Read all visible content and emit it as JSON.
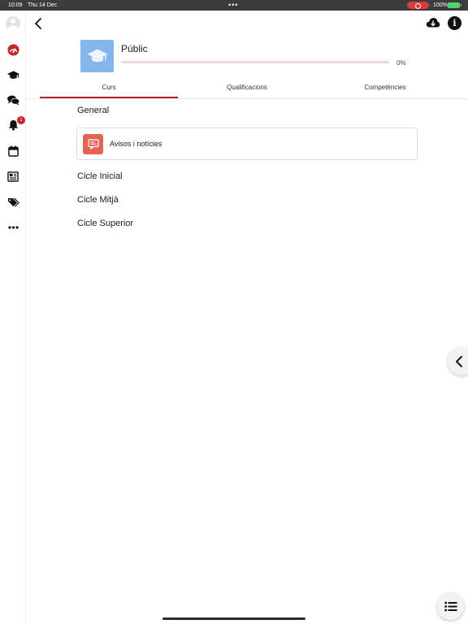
{
  "status_bar": {
    "time": "10:09",
    "date": "Thu 14 Dec",
    "battery": "100%"
  },
  "sidebar": {
    "notification_count": "1",
    "items": [
      {
        "icon": "dashboard-icon"
      },
      {
        "icon": "graduation-cap-icon"
      },
      {
        "icon": "chat-icon"
      },
      {
        "icon": "bell-icon"
      },
      {
        "icon": "calendar-icon"
      },
      {
        "icon": "news-icon"
      },
      {
        "icon": "tags-icon"
      },
      {
        "icon": "more-icon"
      }
    ]
  },
  "course": {
    "title": "Públic",
    "progress_percent": 0,
    "progress_text": "0%"
  },
  "tabs": [
    {
      "label": "Curs",
      "active": true
    },
    {
      "label": "Qualificacions",
      "active": false
    },
    {
      "label": "Competències",
      "active": false
    }
  ],
  "sections": [
    {
      "title": "General",
      "modules": [
        {
          "label": "Avisos i notícies",
          "icon": "forum-icon"
        }
      ]
    },
    {
      "title": "Cicle Inicial"
    },
    {
      "title": "Cicle Mitjà"
    },
    {
      "title": "Cicle Superior"
    }
  ],
  "colors": {
    "accent": "#b3262d",
    "course_image": "#86b4ec",
    "module_icon": "#e46354"
  }
}
